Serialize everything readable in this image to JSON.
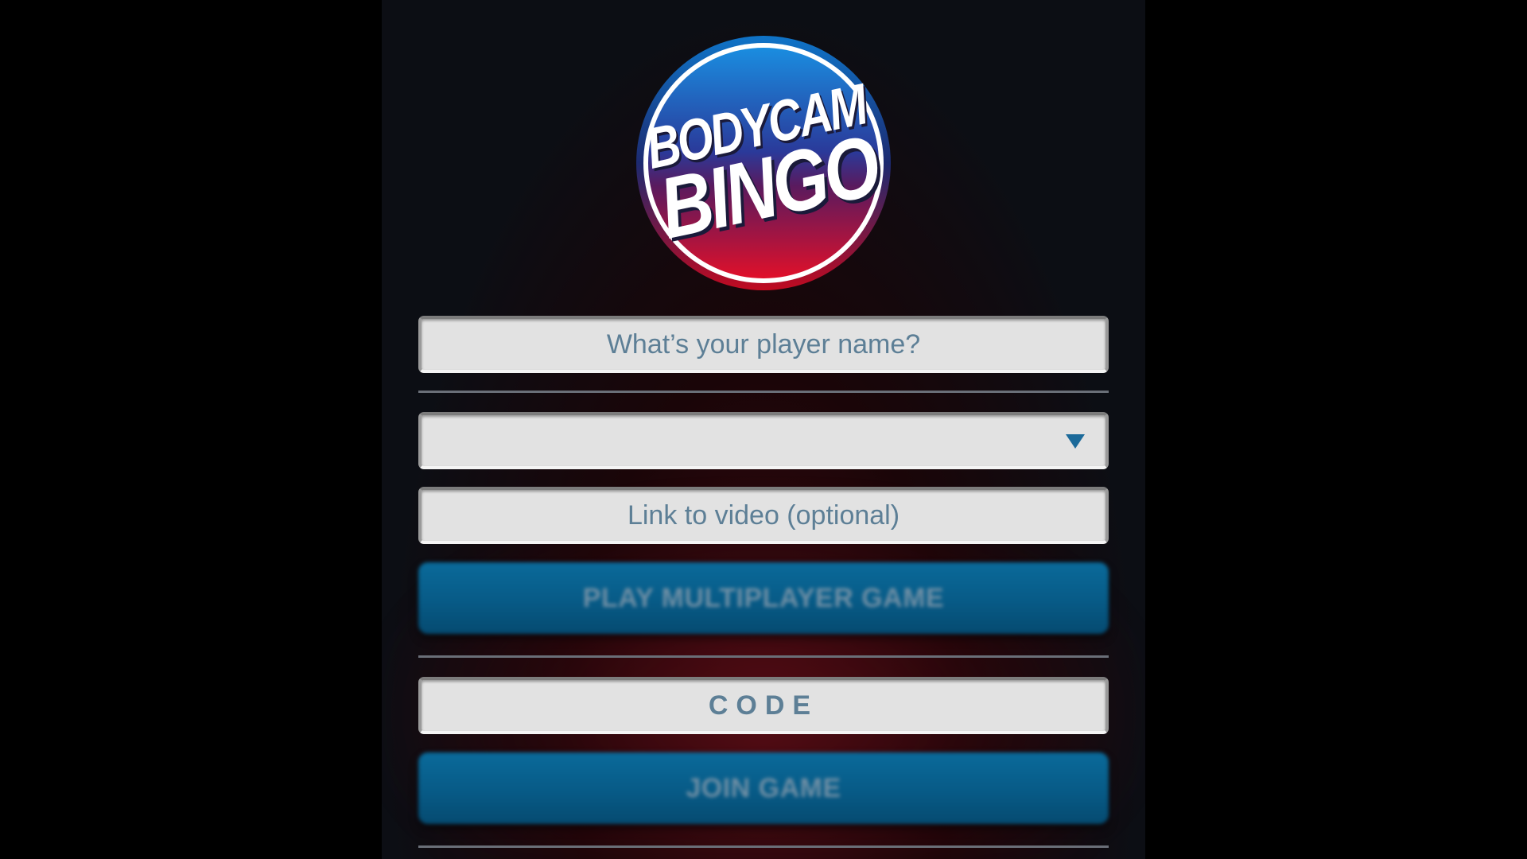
{
  "logo": {
    "line1": "BODYCAM",
    "line2": "BINGO",
    "colors": {
      "top": "#1a8de0",
      "bottom": "#e0102a",
      "ring": "#ffffff"
    }
  },
  "form": {
    "player_name_placeholder": "What’s your player name?",
    "video_link_placeholder": "Link to video (optional)",
    "code_placeholder": "CODE",
    "play_button": "PLAY MULTIPLAYER GAME",
    "join_button": "JOIN GAME",
    "select_icon": "chevron-down-icon"
  },
  "colors": {
    "accent": "#075a86",
    "placeholder_text": "#5d7f96",
    "field_bg": "#e2e2e2"
  }
}
